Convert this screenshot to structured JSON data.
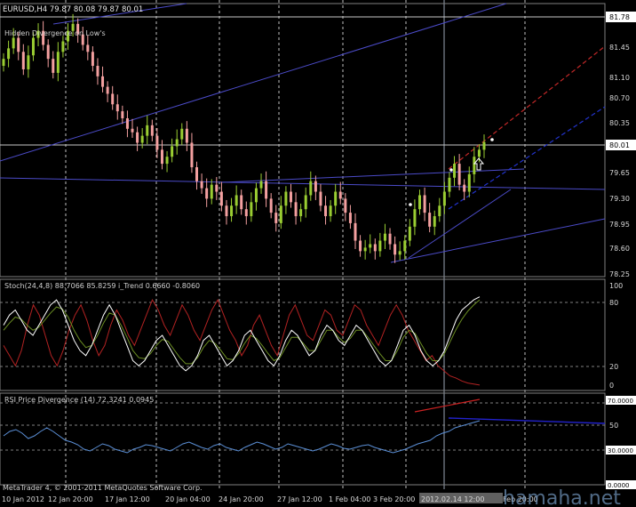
{
  "window": {
    "symbol_header": "EURUSD,H4  79.87 80.08 79.87 80.01",
    "copyright": "MetaTrader 4, © 2001-2011 MetaQuotes Software Corp.",
    "watermark": "hamaha.net"
  },
  "colors": {
    "background": "#000000",
    "bull_candle": "#9acd32",
    "bear_candle": "#f4a0a0",
    "grid": "#c0c0c0",
    "trendline": "#4b4bc8",
    "stoch_main": "#ffffff",
    "stoch_signal": "#6b8e23",
    "itrend": "#b22222",
    "rsi": "#5b8fd6",
    "divergence_red": "#cc2222",
    "divergence_blue": "#2222cc"
  },
  "main_panel": {
    "indicator_label": "Hidden Divergence on Low's",
    "price_labels": [
      "81.45",
      "81.10",
      "80.70",
      "80.35",
      "79.65",
      "79.30",
      "78.95",
      "78.60",
      "78.25"
    ],
    "top_price_box": "81.78",
    "current_price_box": "80.01",
    "arrow_icon": "up-arrow-icon"
  },
  "stoch_panel": {
    "label": "Stoch(24,4,8) 88.7066 85.8259  i_Trend 0.6660 -0.8060",
    "levels": [
      "100",
      "80",
      "20",
      "0"
    ]
  },
  "rsi_panel": {
    "label": "RSI Price Divergence (14) 72.3241 0.0945",
    "levels": [
      "50"
    ],
    "top_box": "70.0000",
    "mid_box": "30.0000",
    "bottom_box": "0.0000"
  },
  "time_axis": {
    "labels": [
      "10 Jan 2012",
      "12 Jan 20:00",
      "17 Jan 12:00",
      "20 Jan 04:00",
      "24 Jan 20:00",
      "27 Jan 12:00",
      "1 Feb 04:00",
      "3 Feb 20:00",
      "8 Feb 12:00",
      "2012.02.14 12:00",
      "Feb 20:00"
    ],
    "highlight_label": "2012.02.14 12:00"
  },
  "chart_data": {
    "type": "candlestick",
    "instrument": "EURUSD",
    "timeframe": "H4",
    "ohlc_last": {
      "open": 79.87,
      "high": 80.08,
      "low": 79.87,
      "close": 80.01
    },
    "ylim": [
      78.2,
      81.8
    ],
    "close_series": [
      81.2,
      81.35,
      81.5,
      81.3,
      81.05,
      81.25,
      81.5,
      81.6,
      81.4,
      81.2,
      81.0,
      81.3,
      81.45,
      81.6,
      81.7,
      81.55,
      81.4,
      81.3,
      81.1,
      80.95,
      80.8,
      80.7,
      80.55,
      80.45,
      80.35,
      80.2,
      80.15,
      80.0,
      80.1,
      80.25,
      80.1,
      79.9,
      79.7,
      79.8,
      79.95,
      80.05,
      80.2,
      80.0,
      79.65,
      79.45,
      79.35,
      79.2,
      79.4,
      79.3,
      79.1,
      78.95,
      79.1,
      79.25,
      79.05,
      78.95,
      79.15,
      79.35,
      79.45,
      79.2,
      79.0,
      78.85,
      79.1,
      79.3,
      79.15,
      78.95,
      79.05,
      79.25,
      79.45,
      79.3,
      79.1,
      78.95,
      79.1,
      79.3,
      79.2,
      79.0,
      78.85,
      78.6,
      78.45,
      78.5,
      78.55,
      78.45,
      78.6,
      78.7,
      78.55,
      78.4,
      78.45,
      78.6,
      78.8,
      79.05,
      79.25,
      79.0,
      78.8,
      78.95,
      79.1,
      79.3,
      79.5,
      79.7,
      79.4,
      79.3,
      79.55,
      79.8,
      79.9,
      80.01
    ],
    "stoch_main": [
      60,
      70,
      75,
      65,
      55,
      50,
      60,
      70,
      80,
      85,
      75,
      60,
      45,
      35,
      30,
      40,
      55,
      70,
      80,
      70,
      55,
      40,
      25,
      20,
      25,
      35,
      45,
      50,
      40,
      30,
      20,
      15,
      20,
      30,
      45,
      50,
      40,
      30,
      20,
      25,
      35,
      50,
      55,
      45,
      35,
      25,
      20,
      30,
      45,
      55,
      50,
      40,
      30,
      35,
      50,
      60,
      55,
      45,
      40,
      50,
      60,
      55,
      45,
      35,
      25,
      20,
      25,
      40,
      55,
      60,
      50,
      35,
      25,
      20,
      25,
      35,
      50,
      65,
      75,
      80,
      85,
      88
    ],
    "stoch_signal": [
      55,
      62,
      68,
      66,
      60,
      55,
      58,
      65,
      72,
      78,
      76,
      68,
      55,
      45,
      38,
      40,
      50,
      62,
      72,
      70,
      60,
      48,
      35,
      28,
      27,
      32,
      40,
      46,
      44,
      36,
      28,
      22,
      22,
      28,
      38,
      45,
      42,
      35,
      27,
      26,
      32,
      42,
      50,
      47,
      40,
      32,
      25,
      28,
      38,
      48,
      48,
      42,
      35,
      35,
      45,
      55,
      55,
      48,
      43,
      47,
      55,
      55,
      48,
      40,
      32,
      25,
      25,
      35,
      48,
      55,
      52,
      42,
      32,
      25,
      25,
      32,
      44,
      56,
      66,
      74,
      80,
      85
    ],
    "itrend": [
      40,
      30,
      20,
      35,
      60,
      80,
      70,
      50,
      30,
      20,
      35,
      55,
      70,
      80,
      65,
      45,
      30,
      40,
      60,
      75,
      65,
      50,
      40,
      55,
      70,
      85,
      75,
      60,
      50,
      65,
      80,
      70,
      55,
      45,
      60,
      75,
      85,
      70,
      55,
      45,
      30,
      40,
      60,
      70,
      55,
      40,
      30,
      50,
      70,
      80,
      65,
      50,
      45,
      60,
      75,
      70,
      55,
      50,
      65,
      80,
      75,
      60,
      50,
      40,
      55,
      70,
      80,
      70,
      55,
      45,
      35,
      25,
      30,
      20,
      15,
      10,
      8,
      5,
      3,
      2,
      1
    ],
    "rsi": [
      55,
      60,
      62,
      58,
      52,
      55,
      60,
      64,
      60,
      55,
      50,
      48,
      45,
      40,
      38,
      42,
      46,
      44,
      40,
      38,
      36,
      40,
      42,
      45,
      44,
      42,
      40,
      38,
      42,
      46,
      48,
      45,
      42,
      40,
      44,
      46,
      42,
      40,
      38,
      42,
      45,
      48,
      46,
      43,
      40,
      42,
      46,
      44,
      42,
      40,
      38,
      40,
      43,
      46,
      44,
      41,
      40,
      42,
      44,
      45,
      42,
      40,
      38,
      36,
      38,
      40,
      43,
      46,
      48,
      50,
      55,
      58,
      60,
      64,
      66,
      68,
      70,
      72
    ]
  }
}
